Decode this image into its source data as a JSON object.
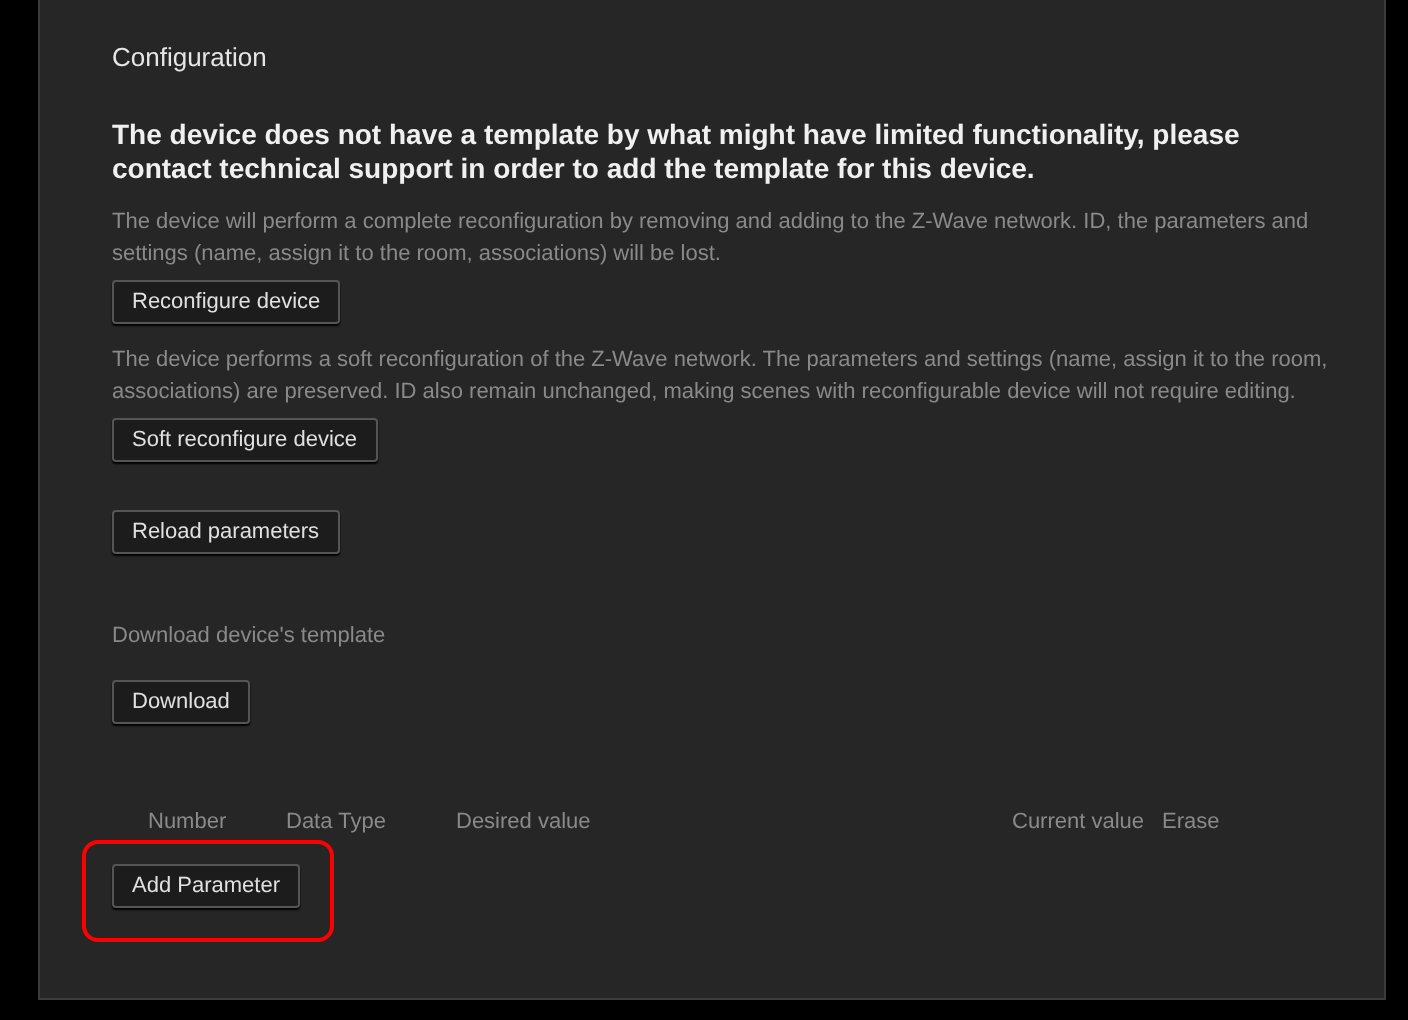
{
  "section_title": "Configuration",
  "warning": "The device does not have a template by what might have limited functionality, please contact technical support in order to add the template for this device.",
  "actions": [
    {
      "description": "The device will perform a complete reconfiguration by removing and adding to the Z-Wave network. ID, the parameters and settings (name, assign it to the room, associations) will be lost.",
      "button": "Reconfigure device"
    },
    {
      "description": "The device performs a soft reconfiguration of the Z-Wave network. The parameters and settings (name, assign it to the room, associations) are preserved. ID also remain unchanged, making scenes with reconfigurable device will not require editing.",
      "button": "Soft reconfigure device"
    },
    {
      "button": "Reload parameters"
    }
  ],
  "template": {
    "label": "Download device's template",
    "button": "Download"
  },
  "table": {
    "columns": [
      "Number",
      "Data Type",
      "Desired value",
      "Current value",
      "Erase"
    ]
  },
  "add_parameter": {
    "label": "Add Parameter",
    "highlighted": true
  }
}
